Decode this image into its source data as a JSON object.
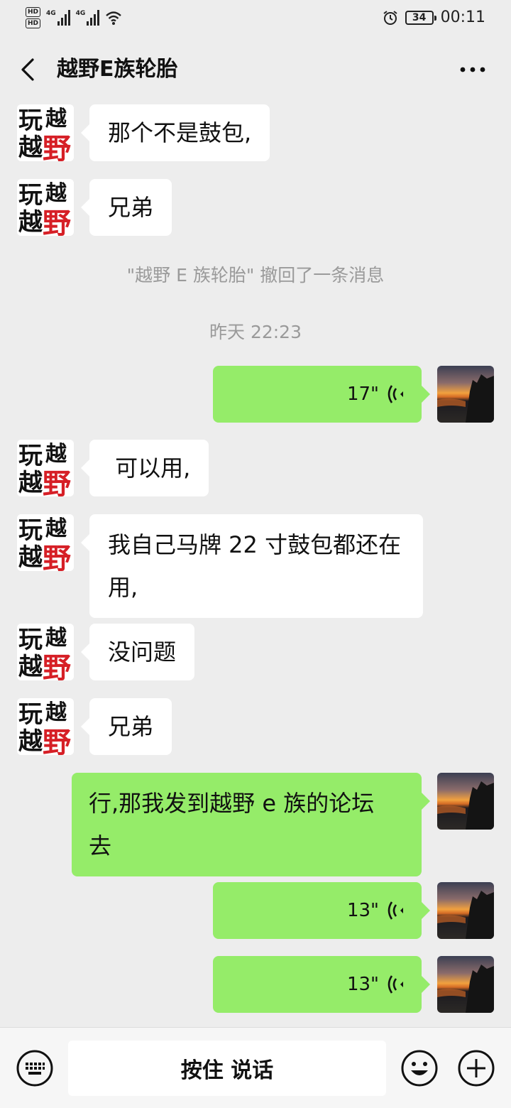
{
  "status_bar": {
    "hd1": "HD",
    "hd2": "HD",
    "net1": "4G",
    "net2": "4G",
    "battery": "34",
    "time": "00:11",
    "icons": [
      "signal-icon",
      "wifi-icon",
      "alarm-icon",
      "battery-icon"
    ]
  },
  "header": {
    "title": "越野E族轮胎",
    "back_icon": "chevron-left-icon",
    "more_icon": "more-dots-icon"
  },
  "messages": [
    {
      "side": "left",
      "type": "text",
      "text": "那个不是鼓包,"
    },
    {
      "side": "left",
      "type": "text",
      "text": "兄弟"
    },
    {
      "type": "system",
      "text": "\"越野 E 族轮胎\" 撤回了一条消息"
    },
    {
      "type": "time",
      "text": "昨天 22:23"
    },
    {
      "side": "right",
      "type": "voice",
      "duration": "17\""
    },
    {
      "side": "left",
      "type": "text",
      "text": " 可以用,"
    },
    {
      "side": "left",
      "type": "text",
      "lines": [
        "我自己马牌 22 寸鼓包都还在",
        "用,"
      ]
    },
    {
      "side": "left",
      "type": "text",
      "text": "没问题"
    },
    {
      "side": "left",
      "type": "text",
      "text": "兄弟"
    },
    {
      "side": "right",
      "type": "text",
      "lines": [
        "行,那我发到越野 e 族的论坛",
        "去"
      ]
    },
    {
      "side": "right",
      "type": "voice",
      "duration": "13\""
    },
    {
      "side": "right",
      "type": "voice",
      "duration": "13\""
    }
  ],
  "avatars": {
    "left_logo_text": [
      "玩",
      "越",
      "越",
      "野"
    ],
    "colors": {
      "logo_black": "#111111",
      "logo_red": "#d61f26"
    }
  },
  "input_bar": {
    "hold_to_talk": "按住 说话",
    "icons": [
      "keyboard-icon",
      "emoji-icon",
      "plus-icon"
    ]
  },
  "colors": {
    "background": "#ededed",
    "bubble_self": "#95ec69",
    "bubble_other": "#ffffff",
    "system_text": "#9a9a9a"
  }
}
